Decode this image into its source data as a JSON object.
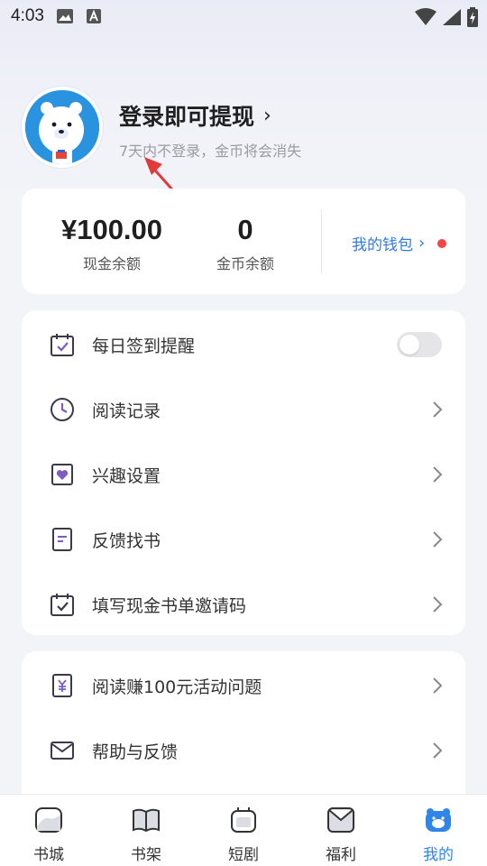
{
  "status_bar": {
    "time": "4:03"
  },
  "profile": {
    "login_title": "登录即可提现",
    "login_chevron": "›",
    "login_subtitle": "7天内不登录，金币将会消失"
  },
  "wallet": {
    "cash_value": "¥100.00",
    "cash_label": "现金余额",
    "coin_value": "0",
    "coin_label": "金币余额",
    "wallet_link": "我的钱包",
    "wallet_chevron": "›"
  },
  "menu_group_1": [
    {
      "label": "每日签到提醒",
      "icon": "calendar-check-icon",
      "control": "toggle",
      "toggle_on": false
    },
    {
      "label": "阅读记录",
      "icon": "clock-icon",
      "control": "chevron"
    },
    {
      "label": "兴趣设置",
      "icon": "heart-frame-icon",
      "control": "chevron"
    },
    {
      "label": "反馈找书",
      "icon": "document-icon",
      "control": "chevron"
    },
    {
      "label": "填写现金书单邀请码",
      "icon": "calendar-check-icon",
      "control": "chevron"
    }
  ],
  "menu_group_2": [
    {
      "label": "阅读赚100元活动问题",
      "icon": "yen-icon",
      "control": "chevron"
    },
    {
      "label": "帮助与反馈",
      "icon": "mail-icon",
      "control": "chevron"
    }
  ],
  "tabs": [
    {
      "label": "书城",
      "icon": "bookstore-icon",
      "active": false
    },
    {
      "label": "书架",
      "icon": "book-open-icon",
      "active": false
    },
    {
      "label": "短剧",
      "icon": "short-drama-icon",
      "active": false
    },
    {
      "label": "福利",
      "icon": "gift-mail-icon",
      "active": false
    },
    {
      "label": "我的",
      "icon": "bear-face-icon",
      "active": true
    }
  ],
  "colors": {
    "accent_blue": "#2f86e8",
    "link_blue": "#2f7ae5",
    "red_dot": "#f04646",
    "annotation_red": "#e03a3a",
    "icon_purple": "#7a5cc4"
  }
}
